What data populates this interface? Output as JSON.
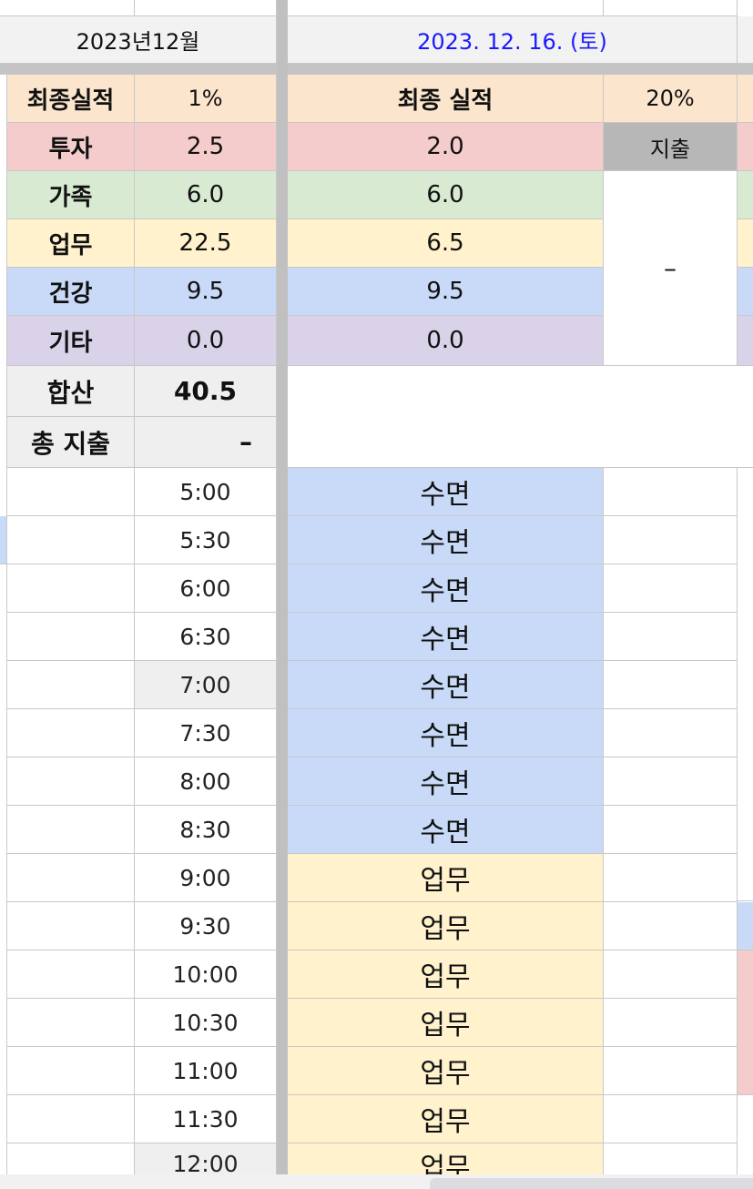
{
  "header": {
    "month": "2023년12월",
    "date": "2023. 12. 16. (토)"
  },
  "colors": {
    "date_text": "#1a1aff",
    "investment": "#f4cccc",
    "family": "#d9ead3",
    "work": "#fff2cc",
    "health": "#c9daf8",
    "other": "#d9d2e9",
    "final": "#fce5cd"
  },
  "summary": {
    "final_label": "최종실적",
    "final_value": "1%",
    "rows": [
      {
        "label": "투자",
        "value": "2.5"
      },
      {
        "label": "가족",
        "value": "6.0"
      },
      {
        "label": "업무",
        "value": "22.5"
      },
      {
        "label": "건강",
        "value": "9.5"
      },
      {
        "label": "기타",
        "value": "0.0"
      }
    ],
    "total_label": "합산",
    "total_value": "40.5",
    "spend_label": "총 지출",
    "spend_value": "–"
  },
  "day": {
    "final_label": "최종 실적",
    "final_value": "20%",
    "values": [
      "2.0",
      "6.0",
      "6.5",
      "9.5",
      "0.0"
    ],
    "spend_label": "지출",
    "spend_value": "–"
  },
  "schedule": [
    {
      "time": "5:00",
      "activity": "수면"
    },
    {
      "time": "5:30",
      "activity": "수면"
    },
    {
      "time": "6:00",
      "activity": "수면"
    },
    {
      "time": "6:30",
      "activity": "수면"
    },
    {
      "time": "7:00",
      "activity": "수면"
    },
    {
      "time": "7:30",
      "activity": "수면"
    },
    {
      "time": "8:00",
      "activity": "수면"
    },
    {
      "time": "8:30",
      "activity": "수면"
    },
    {
      "time": "9:00",
      "activity": "업무"
    },
    {
      "time": "9:30",
      "activity": "업무"
    },
    {
      "time": "10:00",
      "activity": "업무"
    },
    {
      "time": "10:30",
      "activity": "업무"
    },
    {
      "time": "11:00",
      "activity": "업무"
    },
    {
      "time": "11:30",
      "activity": "업무"
    },
    {
      "time": "12:00",
      "activity": "업무"
    }
  ]
}
